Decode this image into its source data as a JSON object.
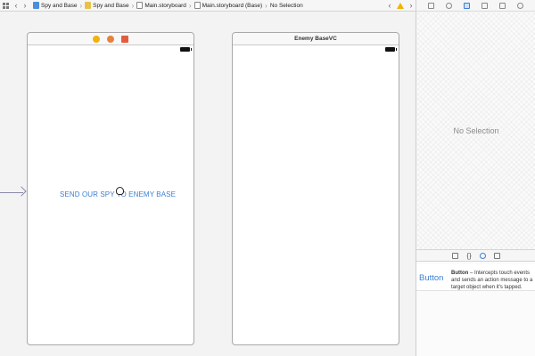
{
  "jump_bar": {
    "breadcrumbs": [
      {
        "label": "Spy and Base",
        "icon": "project-icon"
      },
      {
        "label": "Spy and Base",
        "icon": "folder-icon"
      },
      {
        "label": "Main.storyboard",
        "icon": "storyboard-file-icon"
      },
      {
        "label": "Main.storyboard (Base)",
        "icon": "storyboard-file-icon"
      },
      {
        "label": "No Selection"
      }
    ]
  },
  "canvas": {
    "scene1": {
      "button_label": "SEND OUR SPY TO ENEMY BASE"
    },
    "scene2": {
      "title": "Enemy BaseVC"
    }
  },
  "inspector": {
    "empty_label": "No Selection"
  },
  "library": {
    "item": {
      "icon_label": "Button",
      "title": "Button",
      "description": " – Intercepts touch events and sends an action message to a target object when it's tapped."
    }
  },
  "colors": {
    "accent": "#3b7fd1",
    "warning": "#f0b400"
  }
}
